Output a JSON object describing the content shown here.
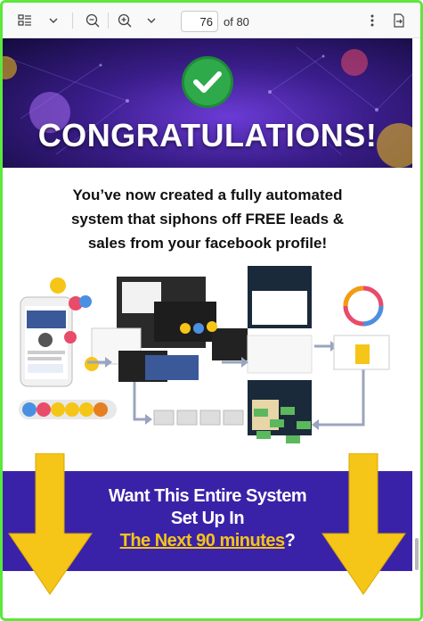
{
  "toolbar": {
    "page_current": "76",
    "page_total_label": "of 80",
    "icons": [
      "thumbnails-icon",
      "chevron-down-icon",
      "zoom-out-icon",
      "zoom-in-icon",
      "chevron-down-icon",
      "more-options-icon",
      "share-export-icon"
    ]
  },
  "banner": {
    "title": "CONGRATULATIONS!"
  },
  "headline": {
    "line1": "You’ve now created a fully automated",
    "line2": "system that siphons off FREE leads &",
    "line3": "sales from your facebook profile!"
  },
  "cta": {
    "line1": "Want This Entire System",
    "line2": "Set Up In",
    "line3_highlight": "The Next 90 minutes",
    "line3_suffix": "?"
  },
  "colors": {
    "frame_border": "#5ce83c",
    "banner_purple": "#3a1d8a",
    "check_green": "#2eaa4a",
    "cta_blue": "#3a22a8",
    "arrow_yellow": "#f5c518"
  }
}
